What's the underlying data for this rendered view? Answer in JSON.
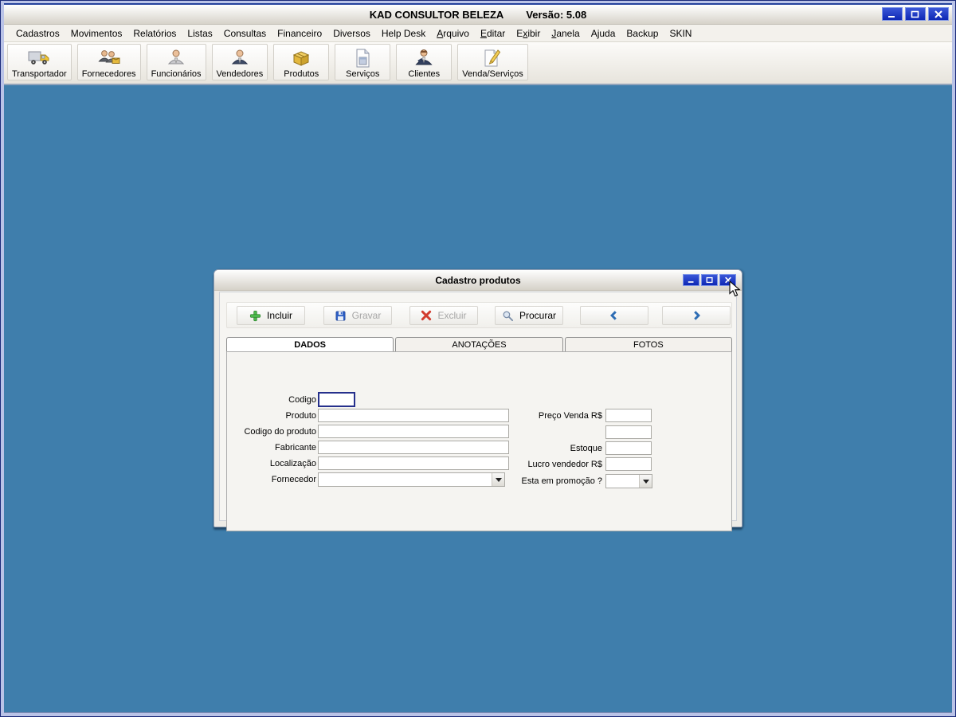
{
  "window": {
    "title": "KAD CONSULTOR BELEZA",
    "version": "Versão: 5.08"
  },
  "menubar": {
    "items": [
      {
        "label": "Cadastros"
      },
      {
        "label": "Movimentos"
      },
      {
        "label": "Relatórios"
      },
      {
        "label": "Listas"
      },
      {
        "label": "Consultas"
      },
      {
        "label": "Financeiro"
      },
      {
        "label": "Diversos"
      },
      {
        "label": "Help Desk"
      },
      {
        "label": "Arquivo",
        "accel": "A"
      },
      {
        "label": "Editar",
        "accel": "E"
      },
      {
        "label": "Exibir",
        "accel": "x"
      },
      {
        "label": "Janela",
        "accel": "J"
      },
      {
        "label": "Ajuda"
      },
      {
        "label": "Backup"
      },
      {
        "label": "SKIN"
      }
    ]
  },
  "toolbar": {
    "buttons": [
      {
        "label": "Transportador",
        "icon": "truck-icon"
      },
      {
        "label": "Fornecedores",
        "icon": "suppliers-icon"
      },
      {
        "label": "Funcionários",
        "icon": "employee-icon"
      },
      {
        "label": "Vendedores",
        "icon": "seller-icon"
      },
      {
        "label": "Produtos",
        "icon": "box-icon"
      },
      {
        "label": "Serviços",
        "icon": "document-icon"
      },
      {
        "label": "Clientes",
        "icon": "client-icon"
      },
      {
        "label": "Venda/Serviços",
        "icon": "document-pencil-icon"
      }
    ]
  },
  "dialog": {
    "title": "Cadastro produtos",
    "buttons": {
      "incluir": "Incluir",
      "gravar": "Gravar",
      "excluir": "Excluir",
      "procurar": "Procurar"
    },
    "tabs": [
      {
        "label": "DADOS",
        "active": true
      },
      {
        "label": "ANOTAÇÕES",
        "active": false
      },
      {
        "label": "FOTOS",
        "active": false
      }
    ],
    "form": {
      "codigo": {
        "label": "Codigo",
        "value": ""
      },
      "produto": {
        "label": "Produto",
        "value": ""
      },
      "codigo_produto": {
        "label": "Codigo do produto",
        "value": ""
      },
      "fabricante": {
        "label": "Fabricante",
        "value": ""
      },
      "localizacao": {
        "label": "Localização",
        "value": ""
      },
      "fornecedor": {
        "label": "Fornecedor",
        "value": ""
      },
      "preco_venda": {
        "label": "Preço Venda R$",
        "value": ""
      },
      "campo_extra": {
        "label": "",
        "value": ""
      },
      "estoque": {
        "label": "Estoque",
        "value": ""
      },
      "lucro_vendedor": {
        "label": "Lucro vendedor R$",
        "value": ""
      },
      "promocao": {
        "label": "Esta em promoção ?",
        "value": ""
      }
    }
  },
  "colors": {
    "client_background": "#3F7EAC",
    "window_button": "#0D27B4",
    "frame": "#BAC3E7",
    "disabled_text": "#A6A6A6",
    "focus_border": "#26308C",
    "accent_green": "#3FAE3F",
    "accent_red": "#D23B2E",
    "accent_blue": "#2E6DB4"
  }
}
